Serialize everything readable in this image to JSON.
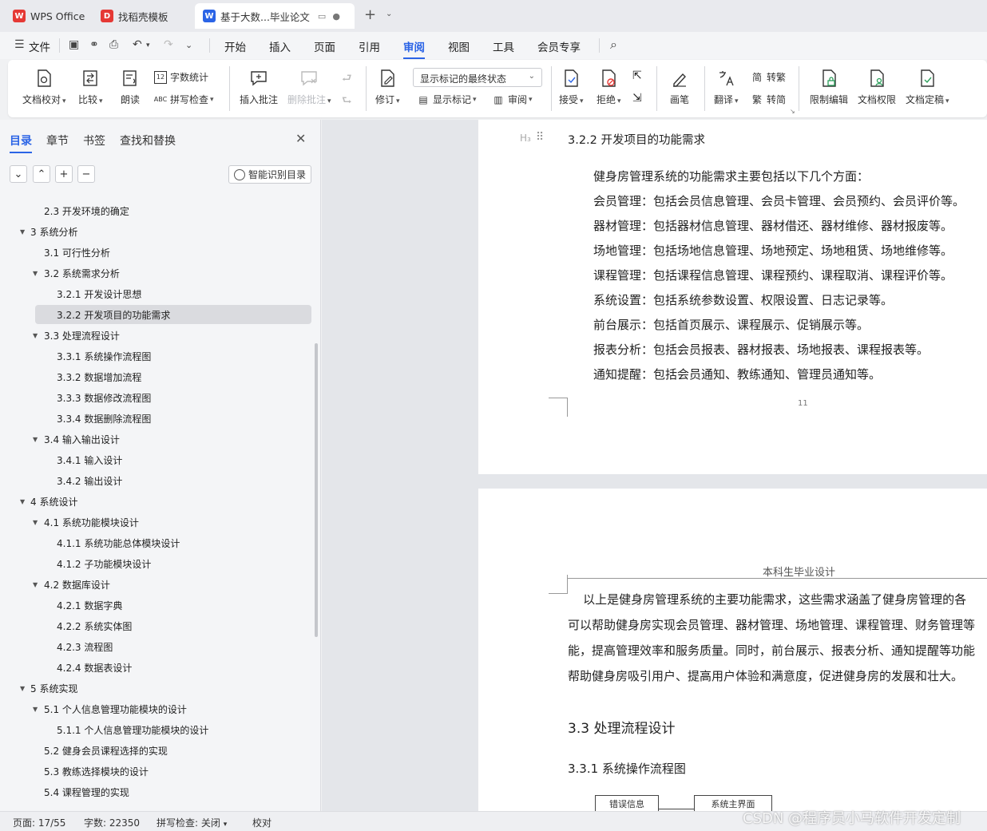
{
  "tabs": [
    {
      "label": "WPS Office",
      "logo": "W",
      "color": "#e53935"
    },
    {
      "label": "找稻壳模板",
      "logo": "D",
      "color": "#e53935"
    },
    {
      "label": "基于大数...毕业论文",
      "logo": "W",
      "color": "#2b64e6"
    }
  ],
  "menu": {
    "file": "文件",
    "items": [
      "开始",
      "插入",
      "页面",
      "引用",
      "审阅",
      "视图",
      "工具",
      "会员专享"
    ],
    "active": "审阅"
  },
  "ribbon": {
    "doc_check": "文档校对",
    "compare": "比较",
    "read_aloud": "朗读",
    "word_count": "字数统计",
    "spell_check": "拼写检查",
    "insert_comment": "插入批注",
    "delete_comment": "删除批注",
    "track_changes": "修订",
    "markup_mode": "显示标记的最终状态",
    "show_markup": "显示标记",
    "review": "审阅",
    "accept": "接受",
    "reject": "拒绝",
    "pen": "画笔",
    "translate": "翻译",
    "to_traditional": "转繁",
    "to_simplified": "转简",
    "restrict_edit": "限制编辑",
    "doc_permission": "文档权限",
    "doc_finalize": "文档定稿"
  },
  "panel": {
    "tabs": [
      "目录",
      "章节",
      "书签",
      "查找和替换"
    ],
    "smart_toc": "智能识别目录",
    "toc": [
      {
        "text": "2.3 开发环境的确定",
        "level": 2,
        "arrow": false
      },
      {
        "text": "3  系统分析",
        "level": 1,
        "arrow": true
      },
      {
        "text": "3.1 可行性分析",
        "level": 2,
        "arrow": false
      },
      {
        "text": "3.2  系统需求分析",
        "level": 2,
        "arrow": true
      },
      {
        "text": "3.2.1  开发设计思想",
        "level": 3,
        "arrow": false
      },
      {
        "text": "3.2.2  开发项目的功能需求",
        "level": 3,
        "arrow": false,
        "selected": true
      },
      {
        "text": "3.3 处理流程设计",
        "level": 2,
        "arrow": true
      },
      {
        "text": "3.3.1 系统操作流程图",
        "level": 3,
        "arrow": false
      },
      {
        "text": "3.3.2 数据增加流程",
        "level": 3,
        "arrow": false
      },
      {
        "text": "3.3.3 数据修改流程图",
        "level": 3,
        "arrow": false
      },
      {
        "text": "3.3.4 数据删除流程图",
        "level": 3,
        "arrow": false
      },
      {
        "text": "3.4 输入输出设计",
        "level": 2,
        "arrow": true
      },
      {
        "text": "3.4.1 输入设计",
        "level": 3,
        "arrow": false
      },
      {
        "text": "3.4.2 输出设计",
        "level": 3,
        "arrow": false
      },
      {
        "text": "4  系统设计",
        "level": 1,
        "arrow": true
      },
      {
        "text": "4.1 系统功能模块设计",
        "level": 2,
        "arrow": true
      },
      {
        "text": "4.1.1 系统功能总体模块设计",
        "level": 3,
        "arrow": false
      },
      {
        "text": "4.1.2 子功能模块设计",
        "level": 3,
        "arrow": false
      },
      {
        "text": "4.2 数据库设计",
        "level": 2,
        "arrow": true
      },
      {
        "text": "4.2.1 数据字典",
        "level": 3,
        "arrow": false
      },
      {
        "text": "4.2.2 系统实体图",
        "level": 3,
        "arrow": false
      },
      {
        "text": "4.2.3 流程图",
        "level": 3,
        "arrow": false
      },
      {
        "text": "4.2.4 数据表设计",
        "level": 3,
        "arrow": false
      },
      {
        "text": "5  系统实现",
        "level": 1,
        "arrow": true
      },
      {
        "text": "5.1 个人信息管理功能模块的设计",
        "level": 2,
        "arrow": true
      },
      {
        "text": "5.1.1 个人信息管理功能模块的设计",
        "level": 3,
        "arrow": false
      },
      {
        "text": "5.2 健身会员课程选择的实现",
        "level": 2,
        "arrow": false
      },
      {
        "text": "5.3 教练选择模块的设计",
        "level": 2,
        "arrow": false
      },
      {
        "text": "5.4 课程管理的实现",
        "level": 2,
        "arrow": false
      }
    ]
  },
  "doc": {
    "page1": {
      "heading_mark": "H₃",
      "heading": "3.2.2  开发项目的功能需求",
      "lines": [
        "健身房管理系统的功能需求主要包括以下几个方面：",
        "会员管理：包括会员信息管理、会员卡管理、会员预约、会员评价等。",
        "器材管理：包括器材信息管理、器材借还、器材维修、器材报废等。",
        "场地管理：包括场地信息管理、场地预定、场地租赁、场地维修等。",
        "课程管理：包括课程信息管理、课程预约、课程取消、课程评价等。",
        "系统设置：包括系统参数设置、权限设置、日志记录等。",
        "前台展示：包括首页展示、课程展示、促销展示等。",
        "报表分析：包括会员报表、器材报表、场地报表、课程报表等。",
        "通知提醒：包括会员通知、教练通知、管理员通知等。"
      ],
      "page_number": "11"
    },
    "page2": {
      "running_head": "本科生毕业设计",
      "lines": [
        "    以上是健身房管理系统的主要功能需求，这些需求涵盖了健身房管理的各",
        "可以帮助健身房实现会员管理、器材管理、场地管理、课程管理、财务管理等",
        "能，提高管理效率和服务质量。同时，前台展示、报表分析、通知提醒等功能",
        "帮助健身房吸引用户、提高用户体验和满意度，促进健身房的发展和壮大。"
      ],
      "h2": "3.3 处理流程设计",
      "h3": "3.3.1 系统操作流程图",
      "flow_box1": "错误信息",
      "flow_box2": "系统主界面"
    }
  },
  "status": {
    "page": "页面: 17/55",
    "words": "字数: 22350",
    "spell": "拼写检查: 关闭",
    "proof": "校对"
  },
  "watermark": "CSDN @程序员小马软件开发定制"
}
